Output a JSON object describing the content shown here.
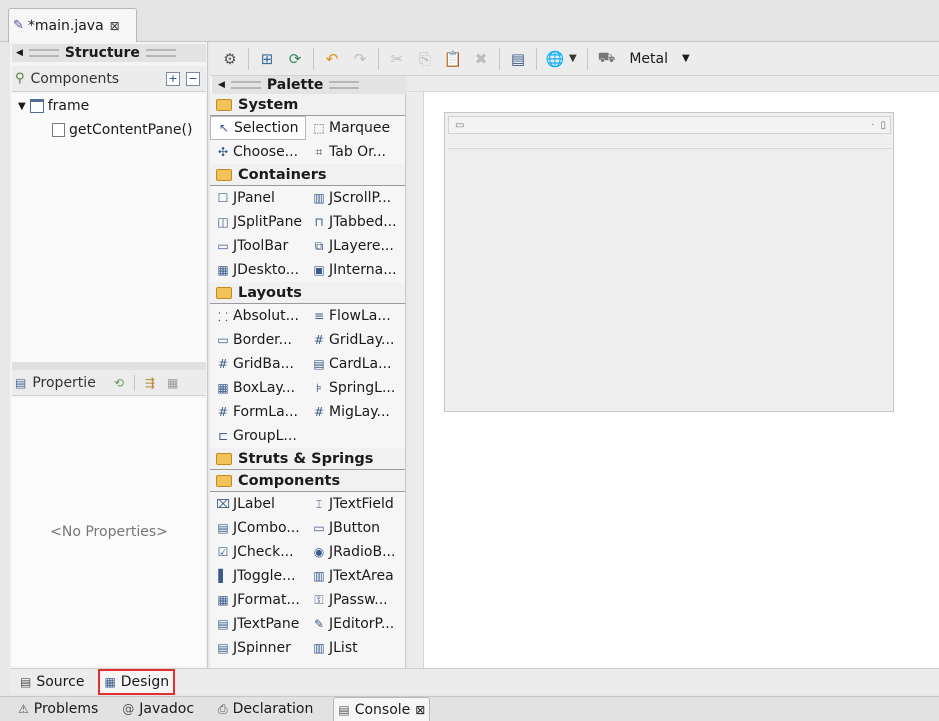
{
  "editor": {
    "tab_title": "*main.java",
    "close_glyph": "⊠"
  },
  "structure": {
    "title": "Structure",
    "components_label": "Components",
    "tree": [
      {
        "label": "frame"
      },
      {
        "label": "getContentPane()"
      }
    ],
    "properties_label": "Propertie",
    "no_properties": "<No Properties>"
  },
  "toolbar": {
    "laf_label": "Metal"
  },
  "palette": {
    "title": "Palette",
    "categories": [
      {
        "name": "System",
        "items": [
          {
            "label": "Selection",
            "icon": "cursor-icon"
          },
          {
            "label": "Marquee",
            "icon": "marquee-icon"
          },
          {
            "label": "Choose...",
            "icon": "choose-icon"
          },
          {
            "label": "Tab Or...",
            "icon": "tab-order-icon"
          }
        ]
      },
      {
        "name": "Containers",
        "items": [
          {
            "label": "JPanel",
            "icon": "jpanel-icon"
          },
          {
            "label": "JScrollP...",
            "icon": "jscrollpane-icon"
          },
          {
            "label": "JSplitPane",
            "icon": "jsplitpane-icon"
          },
          {
            "label": "JTabbed...",
            "icon": "jtabbed-icon"
          },
          {
            "label": "JToolBar",
            "icon": "jtoolbar-icon"
          },
          {
            "label": "JLayere...",
            "icon": "jlayered-icon"
          },
          {
            "label": "JDeskto...",
            "icon": "jdesktop-icon"
          },
          {
            "label": "JInterna...",
            "icon": "jinternal-icon"
          }
        ]
      },
      {
        "name": "Layouts",
        "items": [
          {
            "label": "Absolut...",
            "icon": "absolute-layout-icon"
          },
          {
            "label": "FlowLa...",
            "icon": "flow-layout-icon"
          },
          {
            "label": "Border...",
            "icon": "border-layout-icon"
          },
          {
            "label": "GridLay...",
            "icon": "grid-layout-icon"
          },
          {
            "label": "GridBa...",
            "icon": "gridbag-layout-icon"
          },
          {
            "label": "CardLa...",
            "icon": "card-layout-icon"
          },
          {
            "label": "BoxLay...",
            "icon": "box-layout-icon"
          },
          {
            "label": "SpringL...",
            "icon": "spring-layout-icon"
          },
          {
            "label": "FormLa...",
            "icon": "form-layout-icon"
          },
          {
            "label": "MigLay...",
            "icon": "mig-layout-icon"
          },
          {
            "label": "GroupL...",
            "icon": "group-layout-icon"
          }
        ]
      },
      {
        "name": "Struts & Springs",
        "items": []
      },
      {
        "name": "Components",
        "items": [
          {
            "label": "JLabel",
            "icon": "jlabel-icon"
          },
          {
            "label": "JTextField",
            "icon": "jtextfield-icon"
          },
          {
            "label": "JCombo...",
            "icon": "jcombo-icon"
          },
          {
            "label": "JButton",
            "icon": "jbutton-icon"
          },
          {
            "label": "JCheck...",
            "icon": "jcheck-icon"
          },
          {
            "label": "JRadioB...",
            "icon": "jradio-icon"
          },
          {
            "label": "JToggle...",
            "icon": "jtoggle-icon"
          },
          {
            "label": "JTextArea",
            "icon": "jtextarea-icon"
          },
          {
            "label": "JFormat...",
            "icon": "jformatted-icon"
          },
          {
            "label": "JPassw...",
            "icon": "jpassword-icon"
          },
          {
            "label": "JTextPane",
            "icon": "jtextpane-icon"
          },
          {
            "label": "JEditorP...",
            "icon": "jeditor-icon"
          },
          {
            "label": "JSpinner",
            "icon": "jspinner-icon"
          },
          {
            "label": "JList",
            "icon": "jlist-icon"
          }
        ]
      }
    ]
  },
  "bottom_tabs": {
    "source": "Source",
    "design": "Design"
  },
  "views": [
    {
      "label": "Problems",
      "icon": "problems-icon"
    },
    {
      "label": "Javadoc",
      "icon": "javadoc-icon"
    },
    {
      "label": "Declaration",
      "icon": "declaration-icon"
    },
    {
      "label": "Console",
      "icon": "console-icon"
    }
  ]
}
